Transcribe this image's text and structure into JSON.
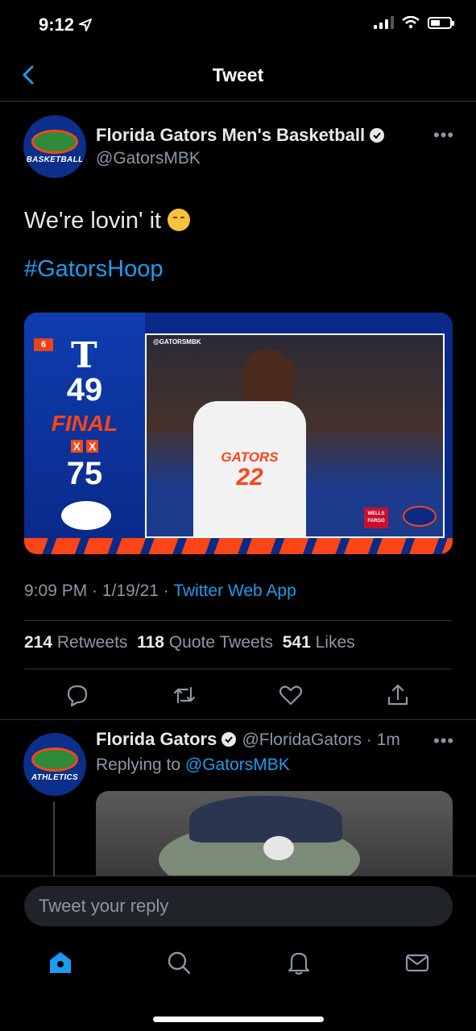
{
  "status_bar": {
    "time": "9:12"
  },
  "header": {
    "title": "Tweet"
  },
  "tweet": {
    "author_name": "Florida Gators Men's Basketball",
    "author_handle": "@GatorsMBK",
    "avatar_text": "BASKETBALL",
    "text": "We're lovin' it",
    "hashtag": "#GatorsHoop",
    "media": {
      "rank": "6",
      "opponent_letter": "T",
      "opponent_score": "49",
      "status": "FINAL",
      "gators_score": "75",
      "tag": "@GATORSMBK",
      "jersey_word": "GATORS",
      "jersey_number": "22",
      "sponsor": "WELLS FARGO"
    },
    "time": "9:09 PM",
    "date": "1/19/21",
    "source": "Twitter Web App",
    "retweets": "214",
    "retweets_label": "Retweets",
    "quote_tweets": "118",
    "quote_tweets_label": "Quote Tweets",
    "likes": "541",
    "likes_label": "Likes"
  },
  "reply": {
    "author_name": "Florida Gators",
    "author_handle": "@FloridaGators",
    "age": "1m",
    "avatar_text": "ATHLETICS",
    "replying_prefix": "Replying to",
    "replying_handle": "@GatorsMBK"
  },
  "composer": {
    "placeholder": "Tweet your reply"
  },
  "colors": {
    "accent": "#1d9bf0",
    "gator_orange": "#fa4616",
    "gator_blue": "#0a2a8a"
  }
}
